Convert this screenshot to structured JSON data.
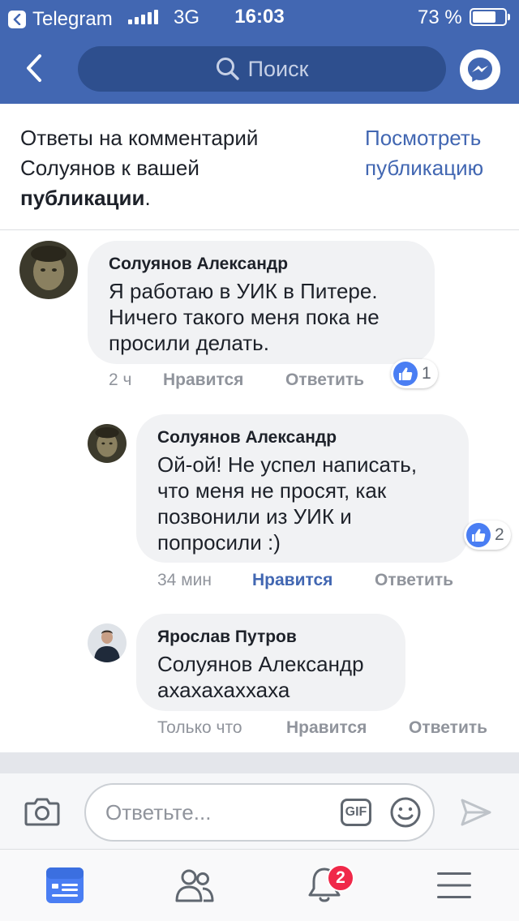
{
  "status_bar": {
    "back_app": "Telegram",
    "network": "3G",
    "time": "16:03",
    "battery": "73 %"
  },
  "nav": {
    "search_placeholder": "Поиск"
  },
  "header": {
    "desc_prefix": "Ответы на комментарий Солуянов к вашей ",
    "desc_bold": "публикации",
    "desc_suffix": ".",
    "view_link": "Посмотреть публикацию"
  },
  "comments": [
    {
      "author": "Солуянов Александр",
      "text": "Я работаю в УИК в Питере. Ничего такого меня пока не просили делать.",
      "time": "2 ч",
      "like": "Нравится",
      "reply": "Ответить",
      "reactions": "1",
      "liked": false
    },
    {
      "author": "Солуянов Александр",
      "text": "Ой-ой! Не успел написать, что меня не просят, как позвонили из УИК и попросили :)",
      "time": "34 мин",
      "like": "Нравится",
      "reply": "Ответить",
      "reactions": "2",
      "liked": true
    },
    {
      "author": "Ярослав Путров",
      "text": "Солуянов Александр ахахахаххаха",
      "time": "Только что",
      "like": "Нравится",
      "reply": "Ответить",
      "liked": false
    }
  ],
  "composer": {
    "placeholder": "Ответьте...",
    "gif_label": "GIF"
  },
  "tabbar": {
    "notifications_badge": "2"
  },
  "colors": {
    "brand": "#4267b2",
    "bubble": "#f1f2f4",
    "badge": "#f02849"
  }
}
